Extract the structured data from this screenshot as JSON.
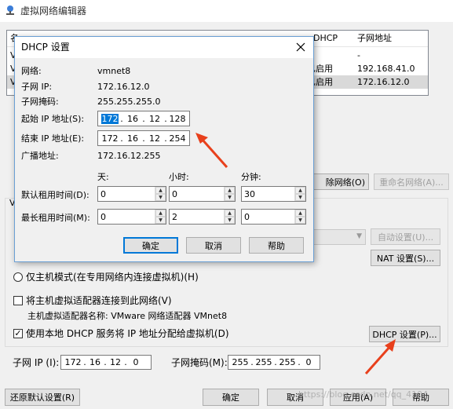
{
  "main": {
    "title": "虚拟网络编辑器",
    "table": {
      "headers": [
        "名",
        "DHCP",
        "子网地址"
      ],
      "rows": [
        {
          "col0": "V",
          "dhcp": "",
          "subnet": "-"
        },
        {
          "col0": "V",
          "dhcp": "已启用",
          "subnet": "192.168.41.0"
        },
        {
          "col0": "V",
          "dhcp": "已启用",
          "subnet": "172.16.12.0"
        }
      ]
    },
    "remove_network_label": "除网络(O)",
    "rename_network_label": "重命名网络(A)...",
    "auto_settings_label": "自动设置(U)...",
    "nat_settings_label": "NAT 设置(S)...",
    "host_only_label": "仅主机模式(在专用网络内连接虚拟机)(H)",
    "connect_host_adapter_label": "将主机虚拟适配器连接到此网络(V)",
    "host_adapter_name": "主机虚拟适配器名称: VMware 网络适配器 VMnet8",
    "use_dhcp_label": "使用本地 DHCP 服务将 IP 地址分配给虚拟机(D)",
    "dhcp_settings_label": "DHCP 设置(P)...",
    "subnet_ip_label": "子网 IP (I):",
    "subnet_ip": [
      "172",
      "16",
      "12",
      "0"
    ],
    "subnet_mask_label": "子网掩码(M):",
    "subnet_mask": [
      "255",
      "255",
      "255",
      "0"
    ],
    "restore_defaults_label": "还原默认设置(R)",
    "ok_label": "确定",
    "cancel_label": "取消",
    "apply_label": "应用(A)",
    "help_label": "帮助",
    "watermark": "https://blog.csdn.net/qq_4104"
  },
  "dialog": {
    "title": "DHCP 设置",
    "network_label": "网络:",
    "network_value": "vmnet8",
    "subnet_ip_label": "子网 IP:",
    "subnet_ip_value": "172.16.12.0",
    "subnet_mask_label": "子网掩码:",
    "subnet_mask_value": "255.255.255.0",
    "start_ip_label": "起始 IP 地址(S):",
    "start_ip": [
      "172",
      "16",
      "12",
      "128"
    ],
    "end_ip_label": "结束 IP 地址(E):",
    "end_ip": [
      "172",
      "16",
      "12",
      "254"
    ],
    "broadcast_label": "广播地址:",
    "broadcast_value": "172.16.12.255",
    "days_label": "天:",
    "hours_label": "小时:",
    "minutes_label": "分钟:",
    "default_lease_label": "默认租用时间(D):",
    "max_lease_label": "最长租用时间(M):",
    "default_lease": {
      "days": "0",
      "hours": "0",
      "minutes": "30"
    },
    "max_lease": {
      "days": "0",
      "hours": "2",
      "minutes": "0"
    },
    "ok_label": "确定",
    "cancel_label": "取消",
    "help_label": "帮助",
    "close_icon": "close-icon"
  },
  "colors": {
    "arrow": "#e8401c",
    "selection": "#0078d7",
    "dialog_border": "#6a9fd4"
  }
}
